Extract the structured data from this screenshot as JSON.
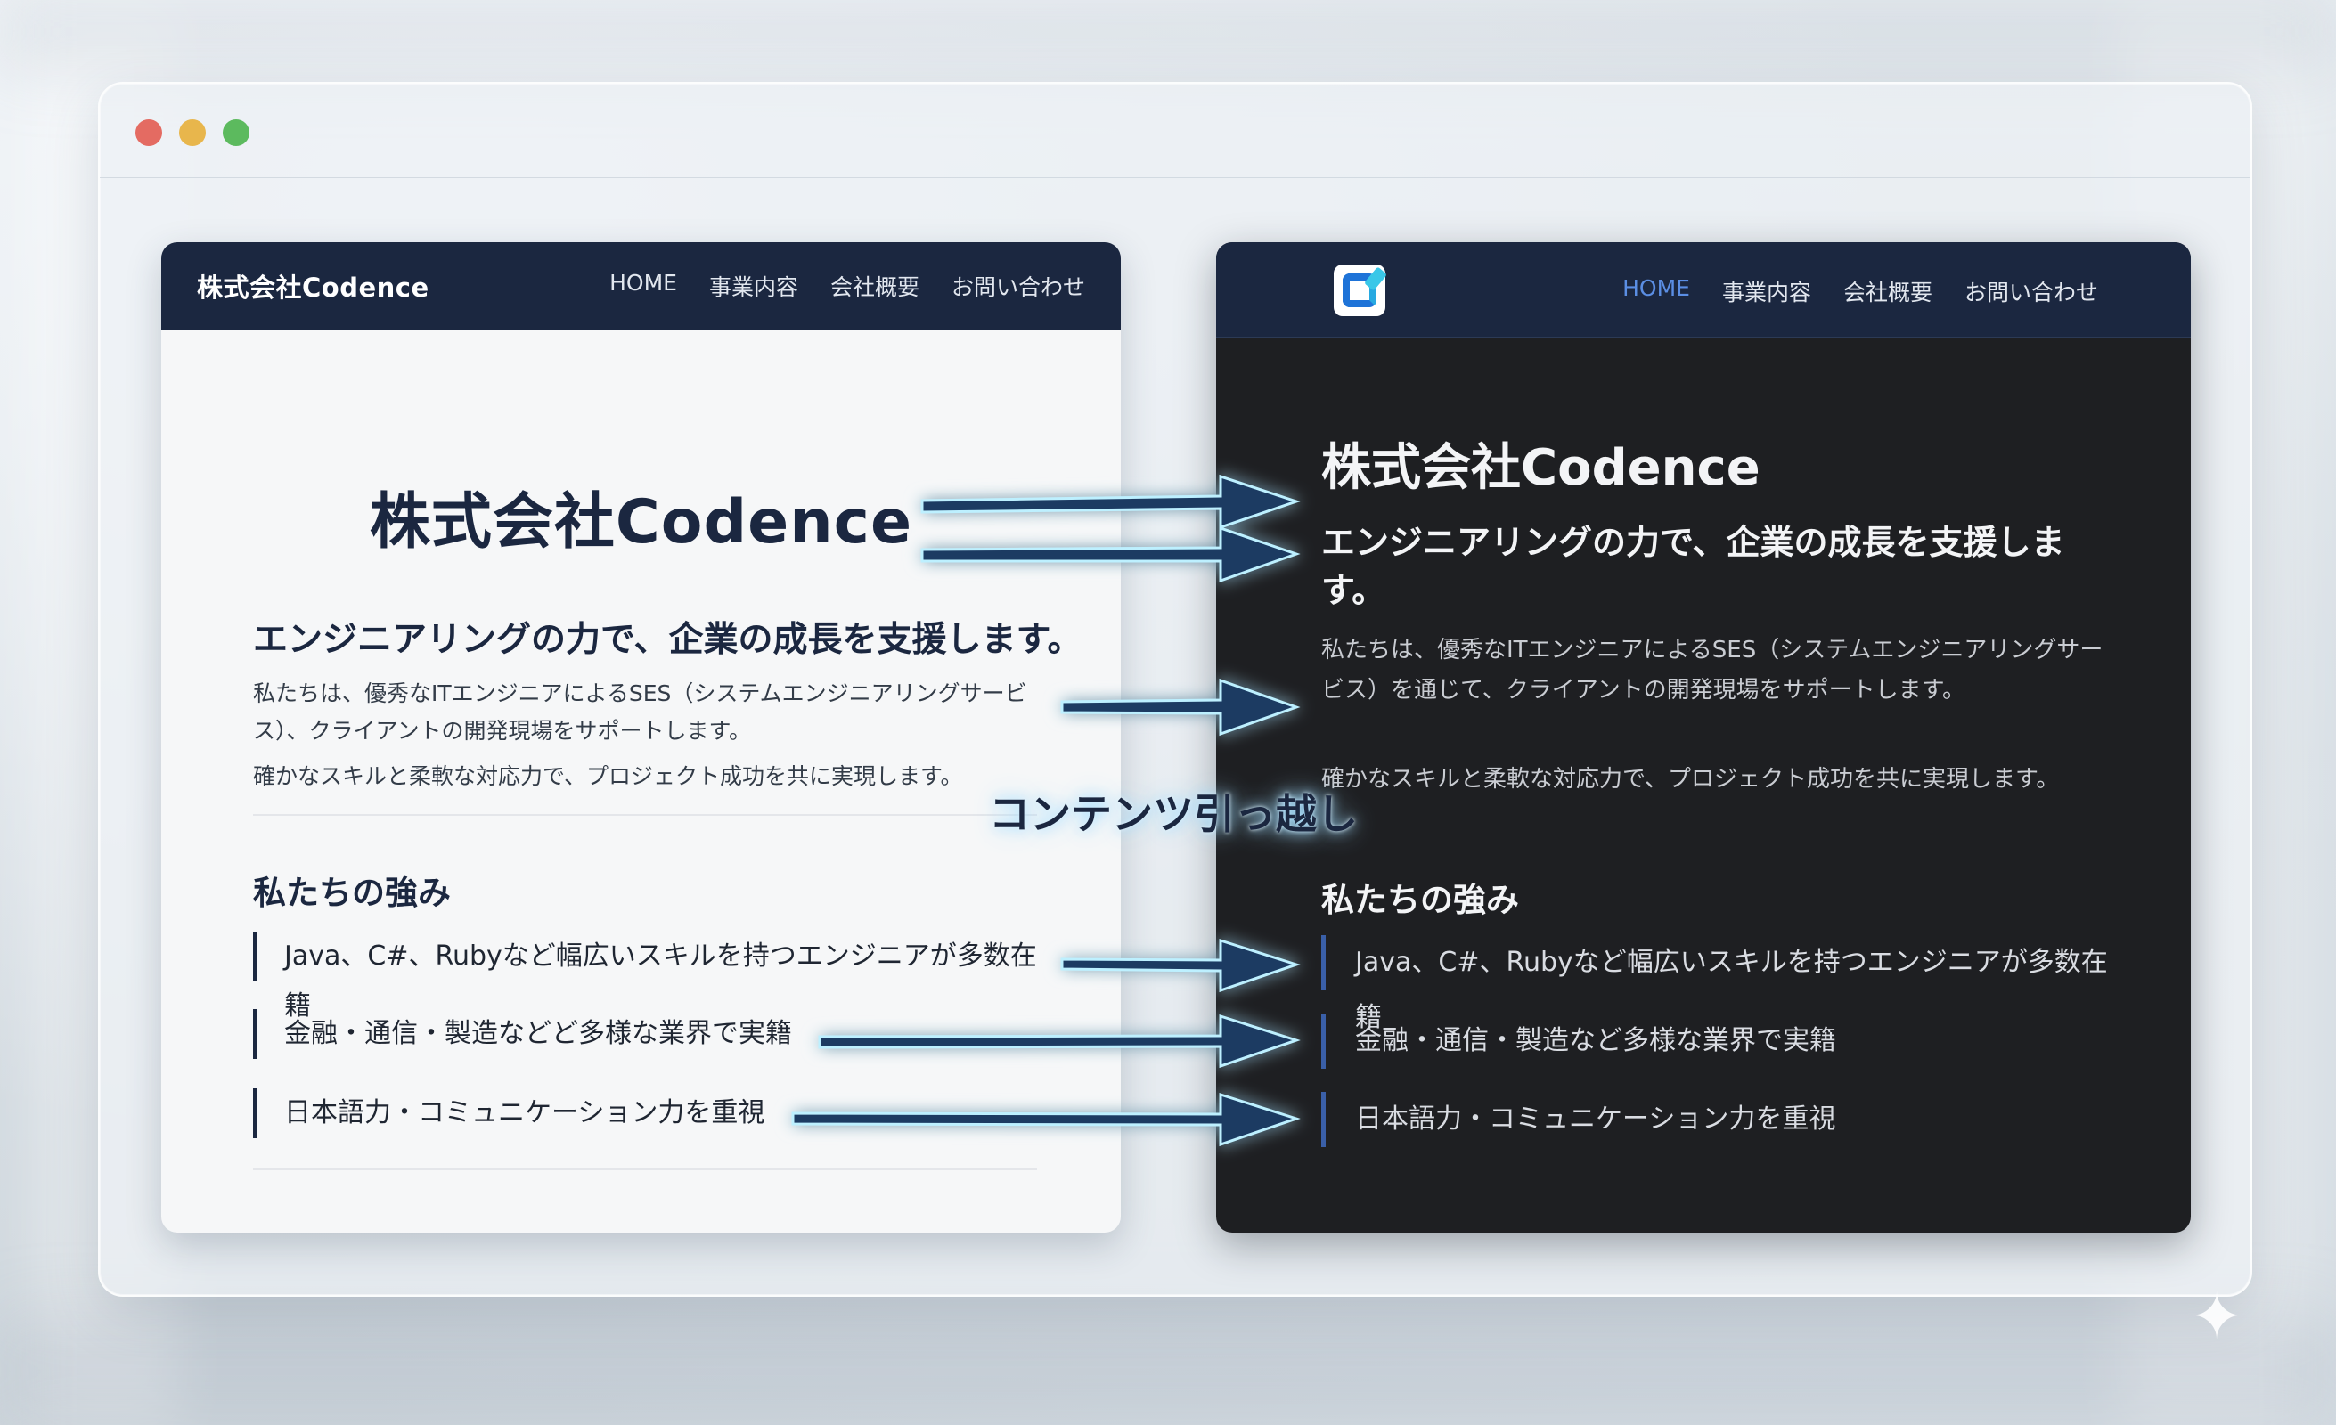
{
  "left_site": {
    "brand": "株式会社Codence",
    "nav": [
      "HOME",
      "事業内容",
      "会社概要",
      "お問い合わせ"
    ],
    "hero_title": "株式会社Codence",
    "tagline": "エンジニアリングの力で、企業の成長を支援します。",
    "paragraph1": "私たちは、優秀なITエンジニアによるSES（システムエンジニアリングサービス）、クライアントの開発現場をサポートします。",
    "paragraph2": "確かなスキルと柔軟な対応力で、プロジェクト成功を共に実現します。",
    "strengths_title": "私たちの強み",
    "strengths": [
      "Java、C#、Rubyなど幅広いスキルを持つエンジニアが多数在籍",
      "金融・通信・製造などど多様な業界で実籍",
      "日本語力・コミュニケーション力を重視"
    ]
  },
  "right_site": {
    "logo_icon": "codence-logo-icon",
    "nav": [
      "HOME",
      "事業内容",
      "会社概要",
      "お問い合わせ"
    ],
    "active_nav": "HOME",
    "hero_title": "株式会社Codence",
    "tagline": "エンジニアリングの力で、企業の成長を支援します。",
    "paragraph1": "私たちは、優秀なITエンジニアによるSES（システムエンジニアリングサービス）を通じて、クライアントの開発現場をサポートします。",
    "paragraph2": "確かなスキルと柔軟な対応力で、プロジェクト成功を共に実現します。",
    "strengths_title": "私たちの強み",
    "strengths": [
      "Java、C#、Rubyなど幅広いスキルを持つエンジニアが多数在籍",
      "金融・通信・製造など多様な業界で実籍",
      "日本語力・コミュニケーション力を重視"
    ]
  },
  "migration_label": "コンテンツ引っ越し",
  "colors": {
    "navy": "#1b2740",
    "active_link": "#5b8ee4",
    "arrow_glow": "#9fe3ff"
  }
}
